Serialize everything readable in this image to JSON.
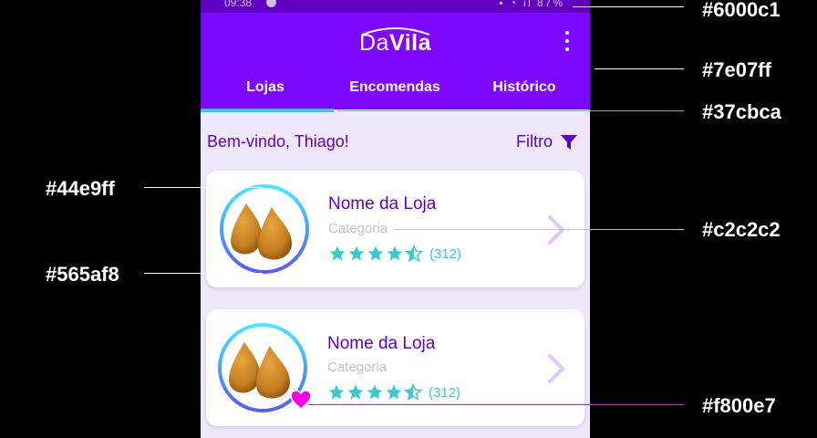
{
  "status_bar": {
    "time": "09:38",
    "right": "▪ ◔ ıl 87%"
  },
  "app": {
    "logo_light": "Da",
    "logo_bold": "Vila"
  },
  "tabs": [
    {
      "label": "Lojas"
    },
    {
      "label": "Encomendas"
    },
    {
      "label": "Histórico"
    }
  ],
  "greeting": "Bem-vindo, Thiago!",
  "filter_label": "Filtro",
  "stores": [
    {
      "name": "Nome da Loja",
      "category": "Categoria",
      "rating": 4.5,
      "reviews": "(312)",
      "favorite": false
    },
    {
      "name": "Nome da Loja",
      "category": "Categoria",
      "rating": 4.5,
      "reviews": "(312)",
      "favorite": true
    }
  ],
  "annotations": {
    "status_bar_color": "#6000c1",
    "app_bar_color": "#7e07ff",
    "tab_indicator_color": "#37cbca",
    "ring_top_color": "#44e9ff",
    "ring_bottom_color": "#565af8",
    "category_color": "#c2c2c2",
    "favorite_color": "#f800e7"
  },
  "colors": {
    "primary_dark": "#6000c1",
    "primary": "#7e07ff",
    "accent": "#37cbca",
    "ring_start": "#44e9ff",
    "ring_end": "#565af8",
    "muted": "#c2c2c2",
    "heart": "#f800e7"
  }
}
